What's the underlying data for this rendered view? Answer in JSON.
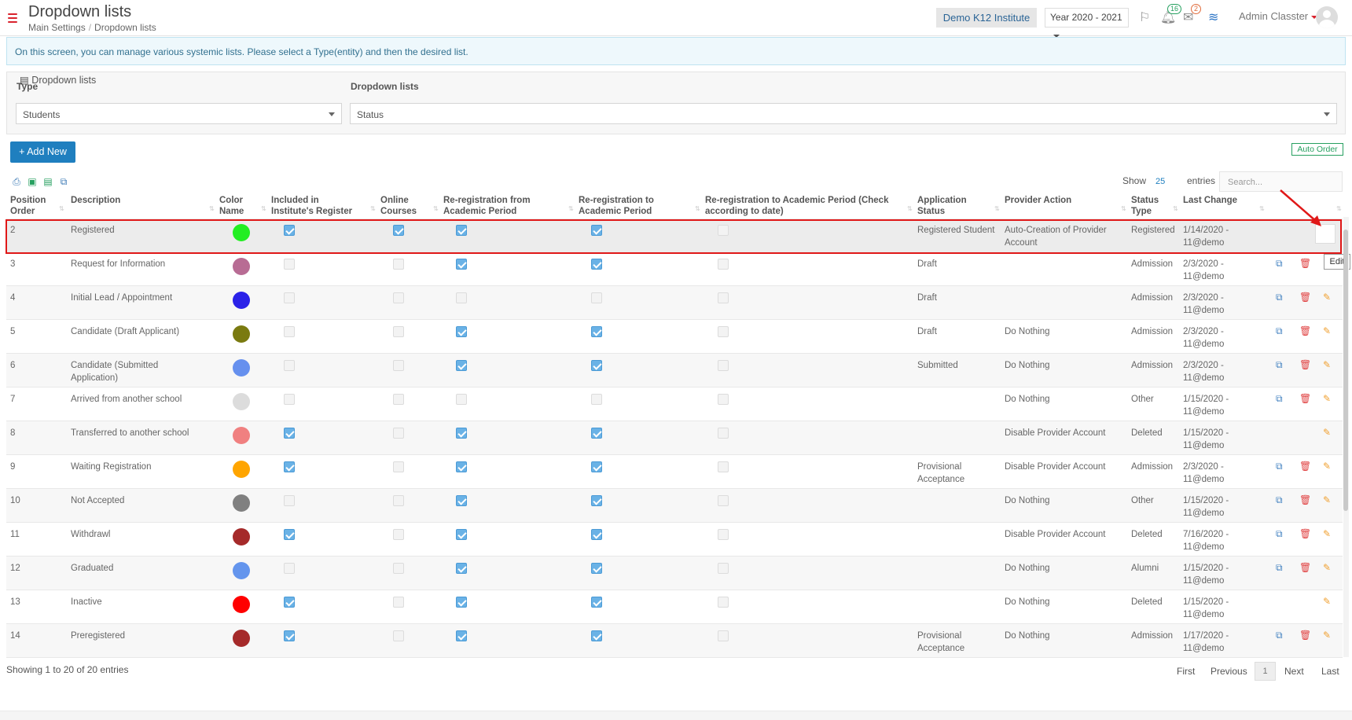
{
  "header": {
    "title": "Dropdown lists",
    "breadcrumb": [
      "Main Settings",
      "Dropdown lists"
    ],
    "institute": "Demo K12 Institute",
    "year": "Year 2020 - 2021",
    "notifications_count": "16",
    "messages_count": "2",
    "user": "Admin Classter"
  },
  "info_text": "On this screen, you can manage various systemic lists. Please select a Type(entity) and then the desired list.",
  "filter": {
    "legend": "Dropdown lists",
    "type_label": "Type",
    "type_value": "Students",
    "list_label": "Dropdown lists",
    "list_value": "Status"
  },
  "buttons": {
    "add_new": "Add New",
    "auto_order": "Auto Order"
  },
  "table_controls": {
    "show": "Show",
    "entries_count": "25",
    "entries": "entries",
    "search_placeholder": "Search..."
  },
  "columns": [
    "Position Order",
    "Description",
    "Color Name",
    "Included in Institute's Register",
    "Online Courses",
    "Re-registration from Academic Period",
    "Re-registration to Academic Period",
    "Re-registration to Academic Period (Check according to date)",
    "Application Status",
    "Provider Action",
    "Status Type",
    "Last Change"
  ],
  "rows": [
    {
      "pos": "2",
      "desc": "Registered",
      "color": "#22ee22",
      "reg": true,
      "online": true,
      "from": true,
      "to": true,
      "check": false,
      "app": "Registered Student",
      "provider": "Auto-Creation of Provider Account",
      "type": "Registered",
      "last": "1/14/2020 - 11@demo",
      "copy": false,
      "del": false,
      "edit": true
    },
    {
      "pos": "3",
      "desc": "Request for Information",
      "color": "#b86c94",
      "reg": false,
      "online": false,
      "from": true,
      "to": true,
      "check": false,
      "app": "Draft",
      "provider": "",
      "type": "Admission",
      "last": "2/3/2020 - 11@demo",
      "copy": true,
      "del": true,
      "edit": true
    },
    {
      "pos": "4",
      "desc": "Initial Lead / Appointment",
      "color": "#2b22e8",
      "reg": false,
      "online": false,
      "from": false,
      "to": false,
      "check": false,
      "app": "Draft",
      "provider": "",
      "type": "Admission",
      "last": "2/3/2020 - 11@demo",
      "copy": true,
      "del": true,
      "edit": true
    },
    {
      "pos": "5",
      "desc": "Candidate (Draft Applicant)",
      "color": "#7a7a10",
      "reg": false,
      "online": false,
      "from": true,
      "to": true,
      "check": false,
      "app": "Draft",
      "provider": "Do Nothing",
      "type": "Admission",
      "last": "2/3/2020 - 11@demo",
      "copy": true,
      "del": true,
      "edit": true
    },
    {
      "pos": "6",
      "desc": "Candidate (Submitted Application)",
      "color": "#6690ee",
      "reg": false,
      "online": false,
      "from": true,
      "to": true,
      "check": false,
      "app": "Submitted",
      "provider": "Do Nothing",
      "type": "Admission",
      "last": "2/3/2020 - 11@demo",
      "copy": true,
      "del": true,
      "edit": true
    },
    {
      "pos": "7",
      "desc": "Arrived from another school",
      "color": "#dcdcdc",
      "reg": false,
      "online": false,
      "from": false,
      "to": false,
      "check": false,
      "app": "",
      "provider": "Do Nothing",
      "type": "Other",
      "last": "1/15/2020 - 11@demo",
      "copy": true,
      "del": true,
      "edit": true
    },
    {
      "pos": "8",
      "desc": "Transferred to another school",
      "color": "#f08080",
      "reg": true,
      "online": false,
      "from": true,
      "to": true,
      "check": false,
      "app": "",
      "provider": "Disable Provider Account",
      "type": "Deleted",
      "last": "1/15/2020 - 11@demo",
      "copy": false,
      "del": false,
      "edit": true
    },
    {
      "pos": "9",
      "desc": "Waiting Registration",
      "color": "#ffa500",
      "reg": true,
      "online": false,
      "from": true,
      "to": true,
      "check": false,
      "app": "Provisional Acceptance",
      "provider": "Disable Provider Account",
      "type": "Admission",
      "last": "2/3/2020 - 11@demo",
      "copy": true,
      "del": true,
      "edit": true
    },
    {
      "pos": "10",
      "desc": "Not Accepted",
      "color": "#808080",
      "reg": false,
      "online": false,
      "from": true,
      "to": true,
      "check": false,
      "app": "",
      "provider": "Do Nothing",
      "type": "Other",
      "last": "1/15/2020 - 11@demo",
      "copy": true,
      "del": true,
      "edit": true
    },
    {
      "pos": "11",
      "desc": "Withdrawl",
      "color": "#a52a2a",
      "reg": true,
      "online": false,
      "from": true,
      "to": true,
      "check": false,
      "app": "",
      "provider": "Disable Provider Account",
      "type": "Deleted",
      "last": "7/16/2020 - 11@demo",
      "copy": true,
      "del": true,
      "edit": true
    },
    {
      "pos": "12",
      "desc": "Graduated",
      "color": "#6495ed",
      "reg": false,
      "online": false,
      "from": true,
      "to": true,
      "check": false,
      "app": "",
      "provider": "Do Nothing",
      "type": "Alumni",
      "last": "1/15/2020 - 11@demo",
      "copy": true,
      "del": true,
      "edit": true
    },
    {
      "pos": "13",
      "desc": "Inactive",
      "color": "#ff0000",
      "reg": true,
      "online": false,
      "from": true,
      "to": true,
      "check": false,
      "app": "",
      "provider": "Do Nothing",
      "type": "Deleted",
      "last": "1/15/2020 - 11@demo",
      "copy": false,
      "del": false,
      "edit": true
    },
    {
      "pos": "14",
      "desc": "Preregistered",
      "color": "#a52a2a",
      "reg": true,
      "online": false,
      "from": true,
      "to": true,
      "check": false,
      "app": "Provisional Acceptance",
      "provider": "Do Nothing",
      "type": "Admission",
      "last": "1/17/2020 - 11@demo",
      "copy": true,
      "del": true,
      "edit": true
    }
  ],
  "edit_tooltip": "Edit",
  "footer": {
    "showing": "Showing 1 to 20 of 20 entries",
    "first": "First",
    "previous": "Previous",
    "page": "1",
    "next": "Next",
    "last": "Last"
  },
  "colors": {
    "accent": "#1f7fbf",
    "highlight": "#e01818",
    "auto_order": "#27a060"
  }
}
